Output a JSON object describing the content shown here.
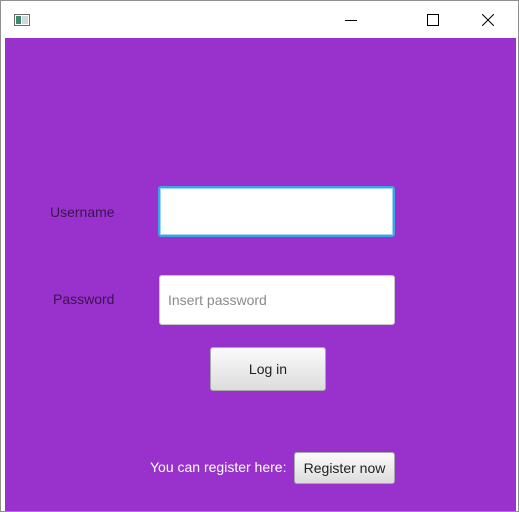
{
  "window": {
    "icon": "app-window-icon",
    "controls": {
      "minimize_icon": "minimize-icon",
      "maximize_icon": "maximize-icon",
      "close_icon": "close-icon"
    }
  },
  "form": {
    "background": "#9932cc",
    "username_label": "Username",
    "username_value": "",
    "password_label": "Password",
    "password_placeholder": "Insert password",
    "login_label": "Log in",
    "register_prompt": "You can register here:",
    "register_label": "Register now"
  }
}
